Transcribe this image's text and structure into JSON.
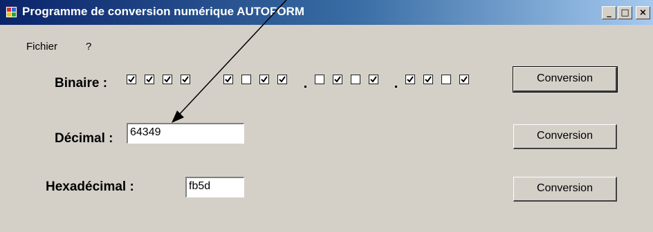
{
  "window": {
    "title": "Programme de conversion numérique AUTOFORM",
    "icon": "app-icon",
    "controls": {
      "minimize": "_",
      "maximize": "□",
      "close": "×"
    }
  },
  "menu": {
    "items": [
      "Fichier",
      "?"
    ]
  },
  "form": {
    "binary_label": "Binaire :",
    "binary_bits": [
      [
        true,
        true,
        true,
        true
      ],
      [
        true,
        false,
        true,
        true
      ],
      [
        false,
        true,
        false,
        true
      ],
      [
        true,
        true,
        false,
        true
      ]
    ],
    "decimal_label": "Décimal :",
    "decimal_value": "64349",
    "hex_label": "Hexadécimal :",
    "hex_value": "fb5d",
    "convert_label": "Conversion"
  },
  "annotation": {
    "type": "arrow-pointing-to-decimal-field",
    "color": "#000000"
  }
}
